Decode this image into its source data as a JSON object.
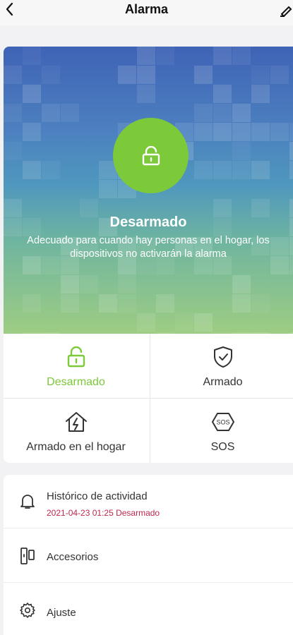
{
  "header": {
    "title": "Alarma"
  },
  "hero": {
    "status_title": "Desarmado",
    "status_description": "Adecuado para cuando hay personas en el hogar, los dispositivos no activarán la alarma",
    "status_color": "#7cc93a"
  },
  "modes": [
    {
      "label": "Desarmado",
      "icon": "unlock-icon",
      "active": true
    },
    {
      "label": "Armado",
      "icon": "shield-check-icon",
      "active": false
    },
    {
      "label": "Armado en el hogar",
      "icon": "home-alarm-icon",
      "active": false
    },
    {
      "label": "SOS",
      "icon": "sos-icon",
      "active": false
    }
  ],
  "list": {
    "activity_label": "Histórico de actividad",
    "activity_last": "2021-04-23 01:25 Desarmado",
    "accessories_label": "Accesorios",
    "settings_label": "Ajuste"
  },
  "colors": {
    "accent": "#7cc93a",
    "alert_text": "#c0284a"
  }
}
